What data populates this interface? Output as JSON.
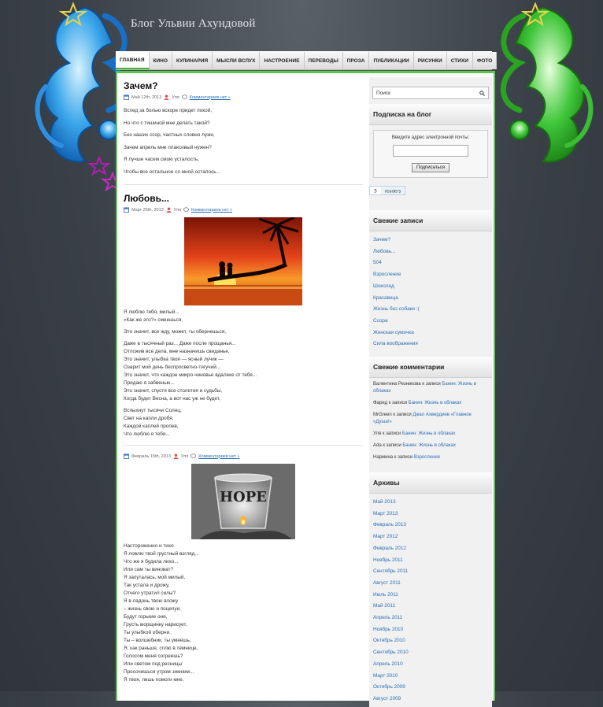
{
  "site": {
    "title": "Блог Ульвии Ахундовой"
  },
  "nav": [
    {
      "label": "ГЛАВНАЯ",
      "active": true
    },
    {
      "label": "КИНО"
    },
    {
      "label": "КУЛИНАРИЯ"
    },
    {
      "label": "МЫСЛИ ВСЛУХ"
    },
    {
      "label": "НАСТРОЕНИЕ"
    },
    {
      "label": "ПЕРЕВОДЫ"
    },
    {
      "label": "ПРОЗА"
    },
    {
      "label": "ПУБЛИКАЦИИ"
    },
    {
      "label": "РИСУНКИ"
    },
    {
      "label": "СТИХИ"
    },
    {
      "label": "ФОТО"
    }
  ],
  "posts": [
    {
      "title": "Зачем?",
      "date": "Май 12th, 2013",
      "author": "Уля",
      "comments": "Комментариев нет »",
      "lines": [
        "Вслед за болью вскоре придет покой,",
        "Но что с тишиной мне делать такой?",
        "Без наших ссор, частных словно лужи,",
        "Зачем апрель мне плаксивый нужен?",
        "Я лучше часем смою усталость,",
        "Чтобы все остальное со мной осталось..."
      ]
    },
    {
      "title": "Любовь...",
      "date": "Март 25th, 2013",
      "author": "Уля",
      "comments": "Комментариев нет »",
      "lines": [
        "Я люблю тебя, милый...",
        "«Как же это?» смеешься,",
        "",
        "Это значит, все жду, может, ты обернешься,",
        "",
        "Даже в тысячный раз... Даже после прощанья...",
        "Отложив все дела, мне назначишь свиданье,",
        "Это значит, улыбка твоя — ясный лучик —",
        "Озарит мой день беспросветно-тягучий...",
        "Это значит, что каждое микро-чиновье вдалеке от тебя...",
        "Придаю я забвенью...",
        "Это значит, спустя все столетия и судьбы,",
        "Когда будет Весна, а вот нас уж не будет,",
        "",
        "Вспыхнут тысячи Солнц,",
        "Свет на капли дробя,",
        "Каждой каплей пропев,",
        "Что люблю я тебя..."
      ]
    },
    {
      "title": "",
      "date": "Февраль 15th, 2013",
      "author": "Уля",
      "comments": "Комментариев нет »",
      "lines": [
        "Настороженно и тихо",
        "Я ловлю твой грустный взгляд...",
        "Что же я будила лихо...",
        "Или сам ты виноват?",
        "Я запуталась, мой милый,",
        "Так устала и дрожу,",
        "Отчего утратил силы?",
        "Я в ладонь твою вложу",
        "– жизнь свою и поцелуи,",
        "Будут горькие они,",
        "Грусть морщинку нарисует,",
        "Ты улыбкой оберни.",
        "Ты – волшебник, ты умеешь,",
        "Я, как раньше, сплю в темнице,",
        "Голосом меня согреешь?",
        "Или светом под ресницы",
        "Просочишься утром зимним...",
        "Я твоя, лишь помоги мне."
      ]
    }
  ],
  "sidebar": {
    "search_placeholder": "Поиск",
    "subscribe_title": "Подписка на блог",
    "subscribe_prompt": "Введите адрес электронной почты:",
    "subscribe_button": "Подписаться",
    "readers_count": "5",
    "readers_label": "readers",
    "recent_title": "Свежие записи",
    "recent": [
      "Зачем?",
      "Любовь...",
      "504",
      "Взросление",
      "Шоколад",
      "Красавица",
      "Жизнь без собаки :(",
      "Ссора",
      "Женская сумочка",
      "Сила воображения"
    ],
    "comments_title": "Свежие комментарии",
    "comments": [
      {
        "author": "Валентина Резникова",
        "sep": " к записи ",
        "post": "Банин: Жизнь в облаках"
      },
      {
        "author": "Фарид",
        "sep": " к записи ",
        "post": "Банин: Жизнь в облаках"
      },
      {
        "author": "MrGreen",
        "sep": " к записи ",
        "post": "Джал Ахвердиев «Главное «Душа!»"
      },
      {
        "author": "Уля",
        "sep": " к записи ",
        "post": "Банин: Жизнь в облаках"
      },
      {
        "author": "Ada",
        "sep": " к записи ",
        "post": "Банин: Жизнь в облаках"
      },
      {
        "author": "Нармина",
        "sep": " к записи ",
        "post": "Взросление"
      }
    ],
    "archives_title": "Архивы",
    "archives": [
      "Май 2013",
      "Март 2013",
      "Февраль 2013",
      "Март 2012",
      "Февраль 2012",
      "Ноябрь 2011",
      "Сентябрь 2011",
      "Август 2011",
      "Июль 2011",
      "Май 2011",
      "Апрель 2011",
      "Ноябрь 2010",
      "Октябрь 2010",
      "Сентябрь 2010",
      "Апрель 2010",
      "Март 2010",
      "Октябрь 2009",
      "Август 2009"
    ]
  },
  "colors": {
    "accent": "#5cc84a",
    "link": "#2a6db5",
    "deco_left": "#2f9be0",
    "deco_right": "#3fc63a"
  },
  "images": {
    "post2": "sunset-couple-palm",
    "post3": "hope-candle-glass"
  }
}
